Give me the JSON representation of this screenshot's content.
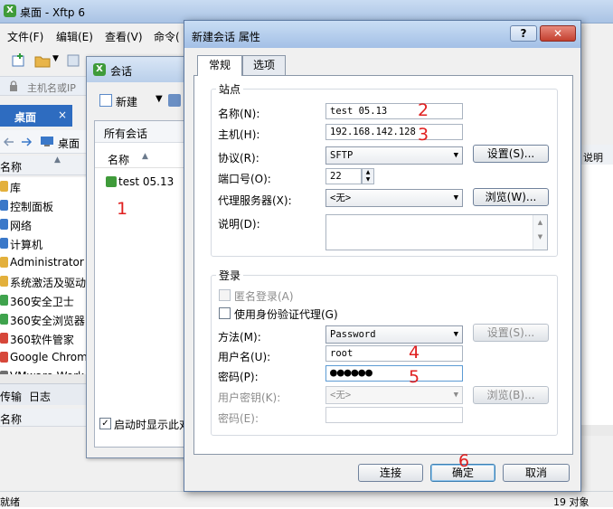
{
  "main_window": {
    "title": "桌面 - Xftp 6",
    "app_icon_glyph": "X",
    "menu": [
      "文件(F)",
      "编辑(E)",
      "查看(V)",
      "命令("
    ],
    "address_placeholder": "主机名或IP",
    "left_tab": {
      "label": "桌面",
      "close": "×"
    },
    "nav_label": "桌面",
    "list_header": "名称",
    "items": [
      {
        "label": "库",
        "color": "#e3b03c"
      },
      {
        "label": "控制面板",
        "color": "#3a78c9"
      },
      {
        "label": "网络",
        "color": "#3a78c9"
      },
      {
        "label": "计算机",
        "color": "#3a78c9"
      },
      {
        "label": "Administrator",
        "color": "#e3b03c"
      },
      {
        "label": "系统激活及驱动",
        "color": "#e3b03c"
      },
      {
        "label": "360安全卫士",
        "color": "#3fa34d"
      },
      {
        "label": "360安全浏览器",
        "color": "#3fa34d"
      },
      {
        "label": "360软件管家",
        "color": "#d6473a"
      },
      {
        "label": "Google Chrome",
        "color": "#d6473a"
      },
      {
        "label": "VMware Work",
        "color": "#6f6f6f"
      }
    ],
    "bottom_tabs": [
      "传输",
      "日志"
    ],
    "bottom_header": "名称",
    "right_header": "说明",
    "status_left": "就绪",
    "status_right": "19 对象"
  },
  "session_dialog": {
    "title": "会话",
    "new_label": "新建",
    "dropdown_glyph": "▼",
    "breadcrumb": "所有会话",
    "column": "名称",
    "sessions": [
      "test 05.13"
    ],
    "startup_checkbox_label": "启动时显示此对",
    "startup_checked": true
  },
  "properties_dialog": {
    "title": "新建会话 属性",
    "help_label": "?",
    "close_label": "✕",
    "tabs": [
      "常规",
      "选项"
    ],
    "site_group": "站点",
    "name_label": "名称(N):",
    "name_value": "test 05.13",
    "host_label": "主机(H):",
    "host_value": "192.168.142.128",
    "protocol_label": "协议(R):",
    "protocol_value": "SFTP",
    "settings_button": "设置(S)...",
    "port_label": "端口号(O):",
    "port_value": "22",
    "proxy_label": "代理服务器(X):",
    "proxy_value": "<无>",
    "browse_button": "浏览(W)...",
    "desc_label": "说明(D):",
    "desc_value": "",
    "login_group": "登录",
    "anonymous_label": "匿名登录(A)",
    "anonymous_checked": false,
    "auth_agent_label": "使用身份验证代理(G)",
    "auth_agent_checked": false,
    "method_label": "方法(M):",
    "method_value": "Password",
    "method_settings_button": "设置(S)...",
    "username_label": "用户名(U):",
    "username_value": "root",
    "password_label": "密码(P):",
    "password_value": "●●●●●●",
    "user_key_label": "用户密钥(K):",
    "user_key_value": "<无>",
    "key_browse_button": "浏览(B)...",
    "passphrase_label": "密码(E):",
    "passphrase_value": "",
    "connect_button": "连接",
    "ok_button": "确定",
    "cancel_button": "取消"
  },
  "annotations": [
    "1",
    "2",
    "3",
    "4",
    "5",
    "6"
  ],
  "colors": {
    "annotation": "#e02020",
    "accent_tab": "#2e6cc0",
    "app_green": "#3f9b3a"
  }
}
